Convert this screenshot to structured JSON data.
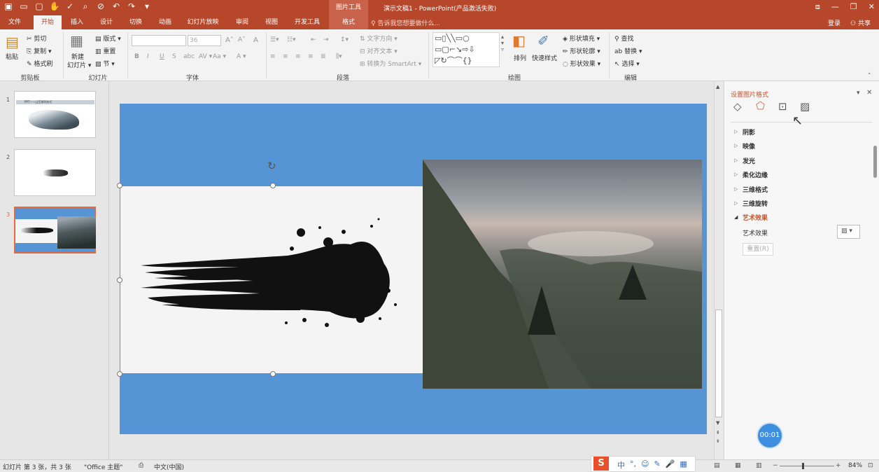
{
  "titlebar": {
    "context_label": "图片工具",
    "document_title": "演示文稿1 - PowerPoint(产品激活失败)",
    "qat_icons": [
      "save-icon",
      "open-icon",
      "new-icon",
      "touch-icon",
      "undo-icon",
      "redo-icon"
    ]
  },
  "tabs": [
    "文件",
    "开始",
    "插入",
    "设计",
    "切换",
    "动画",
    "幻灯片放映",
    "审阅",
    "视图",
    "开发工具",
    "格式"
  ],
  "tellme": "告诉我您想要做什么...",
  "account": {
    "login": "登录",
    "share": "共享"
  },
  "ribbon": {
    "clipboard": {
      "paste": "粘贴",
      "cut": "剪切",
      "copy": "复制",
      "format_painter": "格式刷",
      "label": "剪贴板"
    },
    "slides": {
      "new_slide": "新建",
      "new_slide_2": "幻灯片",
      "layout": "版式",
      "reset": "重置",
      "section": "节",
      "label": "幻灯片"
    },
    "font": {
      "size": "36",
      "label": "字体",
      "bold": "B",
      "italic": "I",
      "underline": "U",
      "strike": "S",
      "grow": "A",
      "shrink": "A",
      "clear": "A",
      "case": "Aa",
      "color": "A"
    },
    "paragraph": {
      "text_direction": "文字方向",
      "align_text": "对齐文本",
      "smartart": "转换为 SmartArt",
      "label": "段落"
    },
    "drawing": {
      "arrange": "排列",
      "quick_styles": "快速样式",
      "fill": "形状填充",
      "outline": "形状轮廓",
      "effects": "形状效果",
      "label": "绘图"
    },
    "editing": {
      "find": "查找",
      "replace": "替换",
      "select": "选择",
      "label": "编辑"
    }
  },
  "thumbnails": [
    {
      "num": "1",
      "caption": "PPT——山峦排列技巧"
    },
    {
      "num": "2"
    },
    {
      "num": "3"
    }
  ],
  "taskpane": {
    "title": "设置图片格式",
    "sections": [
      "阴影",
      "映像",
      "发光",
      "柔化边缘",
      "三维格式",
      "三维旋转",
      "艺术效果"
    ],
    "artistic_label": "艺术效果",
    "reset_button": "重置(R)"
  },
  "timer": "00:01",
  "status": {
    "slide": "幻灯片 第 3 张，共 3 张",
    "theme": "\"Office 主题\"",
    "language": "中文(中国)",
    "zoom": "84%"
  },
  "ime": [
    "中",
    "°,",
    "☺",
    "✎",
    "🎤",
    "▦"
  ],
  "colors": {
    "accent": "#b7472a",
    "slide_bg": "#5595d5"
  }
}
